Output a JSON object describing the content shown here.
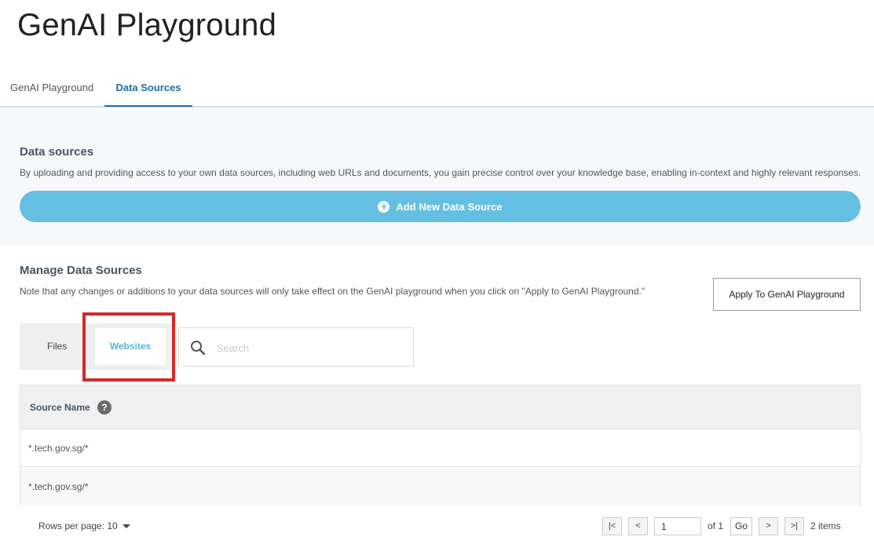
{
  "page_title": "GenAI Playground",
  "tabs": [
    {
      "label": "GenAI Playground",
      "active": false
    },
    {
      "label": "Data Sources",
      "active": true
    }
  ],
  "data_sources": {
    "title": "Data sources",
    "description": "By uploading and providing access to your own data sources, including web URLs and documents, you gain precise control over your knowledge base, enabling in-context and highly relevant responses.",
    "add_button_label": "Add New Data Source"
  },
  "manage": {
    "title": "Manage Data Sources",
    "note": "Note that any changes or additions to your data sources will only take effect on the GenAI playground when you click on \"Apply to GenAI Playground.\"",
    "apply_button_label": "Apply To GenAI Playground",
    "subtabs": [
      {
        "label": "Files",
        "active": false
      },
      {
        "label": "Websites",
        "active": true
      }
    ],
    "search": {
      "placeholder": "Search",
      "value": ""
    }
  },
  "table": {
    "header": "Source Name",
    "help_glyph": "?",
    "rows": [
      "*.tech.gov.sg/*",
      "*.tech.gov.sg/*"
    ]
  },
  "pagination": {
    "rows_per_page_label": "Rows per page: 10",
    "current_page": "1",
    "of_label": "of 1",
    "go_label": "Go",
    "items_label": "2 items",
    "first_glyph": "|<",
    "prev_glyph": "<",
    "next_glyph": ">",
    "last_glyph": ">|"
  },
  "colors": {
    "accent": "#65bfe2",
    "active_tab": "#1d6fa8",
    "highlight": "#d62828"
  },
  "icons": {
    "add": "plus-circle-icon",
    "search": "search-icon",
    "help": "question-circle-icon",
    "rows_dropdown": "caret-down-icon"
  }
}
